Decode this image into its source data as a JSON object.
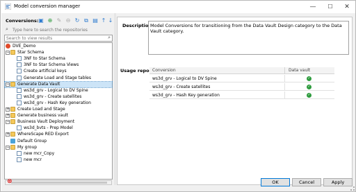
{
  "window": {
    "title": "Model conversion manager",
    "controls": {
      "minimize": "—",
      "maximize": "☐",
      "close": "✕"
    }
  },
  "left": {
    "conversions_label": "Conversions:",
    "toolbar_icons": [
      "new-icon",
      "add-icon",
      "edit-icon",
      "delete-icon",
      "refresh-icon",
      "duplicate-icon",
      "save-icon",
      "move-up-icon",
      "move-down-icon"
    ],
    "search_repo_placeholder": "Type here to search the repositories",
    "search_results_placeholder": "Search to view results",
    "tree": [
      {
        "label": "DVE_Demo",
        "level": 0,
        "type": "root",
        "expander": ""
      },
      {
        "label": "Star Schema",
        "level": 1,
        "type": "folder",
        "expander": "−"
      },
      {
        "label": "3NF to Star Schema",
        "level": 2,
        "type": "doc",
        "expander": ""
      },
      {
        "label": "3NF to Star Schema Views",
        "level": 2,
        "type": "doc",
        "expander": ""
      },
      {
        "label": "Create artificial keys",
        "level": 2,
        "type": "doc",
        "expander": ""
      },
      {
        "label": "Generate Load and Stage tables",
        "level": 2,
        "type": "doc",
        "expander": ""
      },
      {
        "label": "Generate Data Vault",
        "level": 1,
        "type": "folder",
        "expander": "−",
        "selected": true
      },
      {
        "label": "ws3d_grv - Logical to DV Spine",
        "level": 2,
        "type": "doc",
        "expander": ""
      },
      {
        "label": "ws3d_grv - Create satellites",
        "level": 2,
        "type": "doc",
        "expander": ""
      },
      {
        "label": "ws3d_grv - Hash Key generation",
        "level": 2,
        "type": "doc",
        "expander": ""
      },
      {
        "label": "Create Load and Stage",
        "level": 1,
        "type": "folder",
        "expander": "+"
      },
      {
        "label": "Generate business vault",
        "level": 1,
        "type": "folder",
        "expander": "+"
      },
      {
        "label": "Business Vault Deployment",
        "level": 1,
        "type": "folder",
        "expander": "−"
      },
      {
        "label": "ws3d_bvts - Prep Model",
        "level": 2,
        "type": "doc",
        "expander": ""
      },
      {
        "label": "WhereScape RED Export",
        "level": 1,
        "type": "folder",
        "expander": "+"
      },
      {
        "label": "Default Group",
        "level": 1,
        "type": "group",
        "expander": ""
      },
      {
        "label": "My group",
        "level": 1,
        "type": "folder",
        "expander": "−"
      },
      {
        "label": "new mcr_Copy",
        "level": 2,
        "type": "doc",
        "expander": ""
      },
      {
        "label": "new mcr",
        "level": 2,
        "type": "doc",
        "expander": ""
      }
    ]
  },
  "right": {
    "description_label": "Description:",
    "description_text": "Model Conversions for transitioning from the Data Vault Design category to the Data Vault category.",
    "usage_label": "Usage report:",
    "usage_columns": [
      "Conversion",
      "Data vault"
    ],
    "usage_rows": [
      {
        "conversion": "ws3d_grv - Logical to DV Spine",
        "check": "✓"
      },
      {
        "conversion": "ws3d_grv - Create satellites",
        "check": "✓"
      },
      {
        "conversion": "ws3d_grv - Hash Key generation",
        "check": "✓"
      }
    ]
  },
  "buttons": {
    "ok": "OK",
    "cancel": "Cancel",
    "apply": "Apply"
  },
  "colors": {
    "selection": "#cce4f7",
    "check_green": "#2e9b3e",
    "folder": "#f5c85a"
  }
}
